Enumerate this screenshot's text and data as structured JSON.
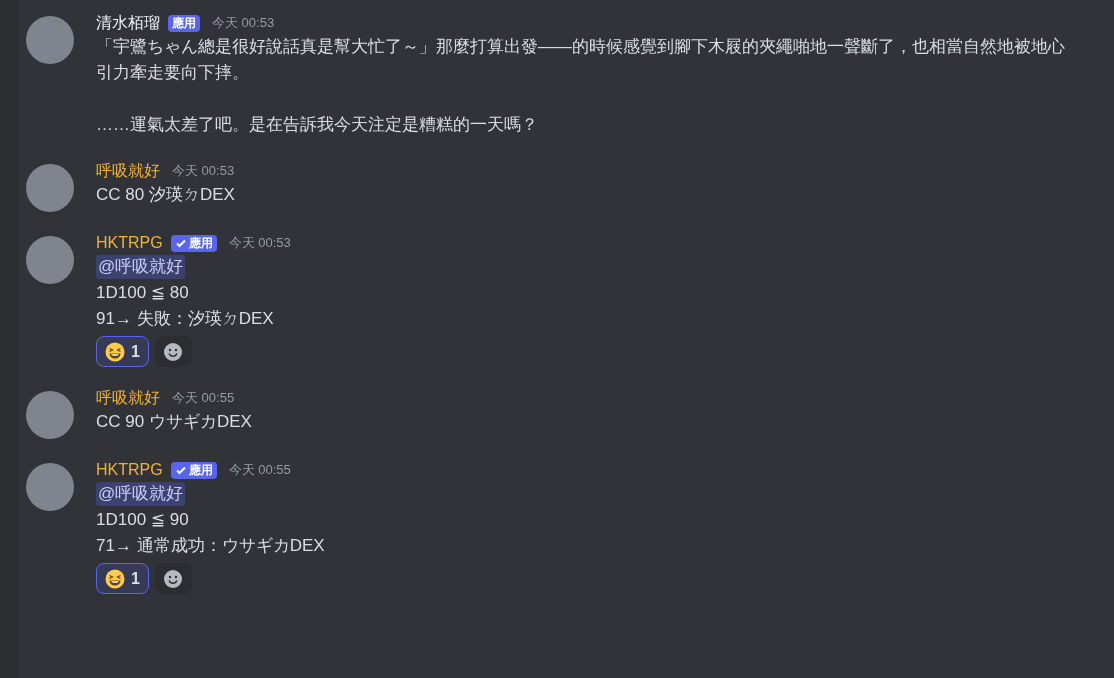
{
  "messages": [
    {
      "author": "清水栢瑠",
      "color": "#f2f3f5",
      "badge": {
        "kind": "app",
        "label": "應用"
      },
      "time": "今天 00:53",
      "lines": [
        {
          "kind": "text",
          "text": "「宇鷺ちゃん總是很好說話真是幫大忙了～」那麼打算出發——的時候感覺到腳下木屐的夾繩啪地一聲斷了，也相當自然地被地心引力牽走要向下摔。\n\n……運氣太差了吧。是在告訴我今天注定是糟糕的一天嗎？"
        }
      ]
    },
    {
      "author": "呼吸就好",
      "color": "#f0b232",
      "time": "今天 00:53",
      "lines": [
        {
          "kind": "text",
          "text": "CC 80 汐瑛ㄉDEX"
        }
      ]
    },
    {
      "author": "HKTRPG",
      "color": "#f0b232",
      "badge": {
        "kind": "verified",
        "label": "應用"
      },
      "time": "今天 00:53",
      "lines": [
        {
          "kind": "mention",
          "text": "@呼吸就好"
        },
        {
          "kind": "text",
          "text": "1D100 ≦ 80"
        },
        {
          "kind": "text",
          "text": "91→ 失敗：汐瑛ㄉDEX"
        }
      ],
      "reactions": [
        {
          "count": "1",
          "selected": true
        }
      ]
    },
    {
      "author": "呼吸就好",
      "color": "#f0b232",
      "time": "今天 00:55",
      "lines": [
        {
          "kind": "text",
          "text": "CC 90 ウサギカDEX"
        }
      ]
    },
    {
      "author": "HKTRPG",
      "color": "#f0b232",
      "badge": {
        "kind": "verified",
        "label": "應用"
      },
      "time": "今天 00:55",
      "lines": [
        {
          "kind": "mention",
          "text": "@呼吸就好"
        },
        {
          "kind": "text",
          "text": "1D100 ≦ 90"
        },
        {
          "kind": "text",
          "text": "71→ 通常成功：ウサギカDEX"
        }
      ],
      "reactions": [
        {
          "count": "1",
          "selected": true
        }
      ]
    }
  ]
}
